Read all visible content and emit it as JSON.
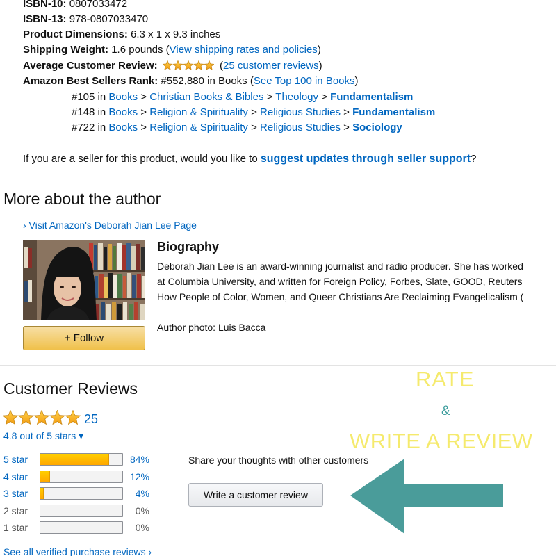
{
  "details": {
    "isbn10": {
      "label": "ISBN-10:",
      "value": "0807033472"
    },
    "isbn13": {
      "label": "ISBN-13:",
      "value": "978-0807033470"
    },
    "dimensions": {
      "label": "Product Dimensions:",
      "value": "6.3 x 1 x 9.3 inches"
    },
    "weight": {
      "label": "Shipping Weight:",
      "value": "1.6 pounds (",
      "link": "View shipping rates and policies",
      "close": ")"
    },
    "avg_review": {
      "label": "Average Customer Review:",
      "open": "(",
      "link": "25 customer reviews",
      "close": ")",
      "rating": 5
    },
    "bsr": {
      "label": "Amazon Best Sellers Rank:",
      "value": "#552,880 in Books (",
      "link": "See Top 100 in Books",
      "close": ")"
    },
    "ranks": [
      {
        "num": "#105 in",
        "path": [
          "Books",
          "Christian Books & Bibles",
          "Theology"
        ],
        "final": "Fundamentalism"
      },
      {
        "num": "#148 in",
        "path": [
          "Books",
          "Religion & Spirituality",
          "Religious Studies"
        ],
        "final": "Fundamentalism"
      },
      {
        "num": "#722 in",
        "path": [
          "Books",
          "Religion & Spirituality",
          "Religious Studies"
        ],
        "final": "Sociology"
      }
    ],
    "sep": ">",
    "seller": {
      "prefix": "If you are a seller for this product, would you like to",
      "link": "suggest updates through seller support",
      "suffix": "?"
    }
  },
  "author": {
    "heading": "More about the author",
    "visit_link": "› Visit Amazon's Deborah Jian Lee Page",
    "follow_label": "+ Follow",
    "bio_heading": "Biography",
    "bio_lines": [
      "Deborah Jian Lee is an award-winning journalist and radio producer. She has worked",
      "at Columbia University, and written for Foreign Policy, Forbes, Slate, GOOD, Reuters",
      "How People of Color, Women, and Queer Christians Are Reclaiming Evangelicalism ("
    ],
    "photo_credit": "Author photo: Luis Bacca"
  },
  "reviews": {
    "heading": "Customer Reviews",
    "count": "25",
    "rating": 4.8,
    "out_of": "4.8 out of 5 stars ▾",
    "histogram": [
      {
        "label": "5 star",
        "pct": "84%",
        "value": 84,
        "link": true
      },
      {
        "label": "4 star",
        "pct": "12%",
        "value": 12,
        "link": true
      },
      {
        "label": "3 star",
        "pct": "4%",
        "value": 4,
        "link": true
      },
      {
        "label": "2 star",
        "pct": "0%",
        "value": 0,
        "link": false
      },
      {
        "label": "1 star",
        "pct": "0%",
        "value": 0,
        "link": false
      }
    ],
    "see_all": "See all verified purchase reviews ›",
    "share": "Share your thoughts with other customers",
    "write_button": "Write a customer review"
  },
  "overlay": {
    "rate": "RATE",
    "amp": "&",
    "write": "WRITE A REVIEW",
    "text_color": "#f5ea6d",
    "arrow_color": "#4a9c9a"
  },
  "colors": {
    "link": "#0066c0",
    "star": "#ffa41c",
    "button": "#f0c14b"
  }
}
